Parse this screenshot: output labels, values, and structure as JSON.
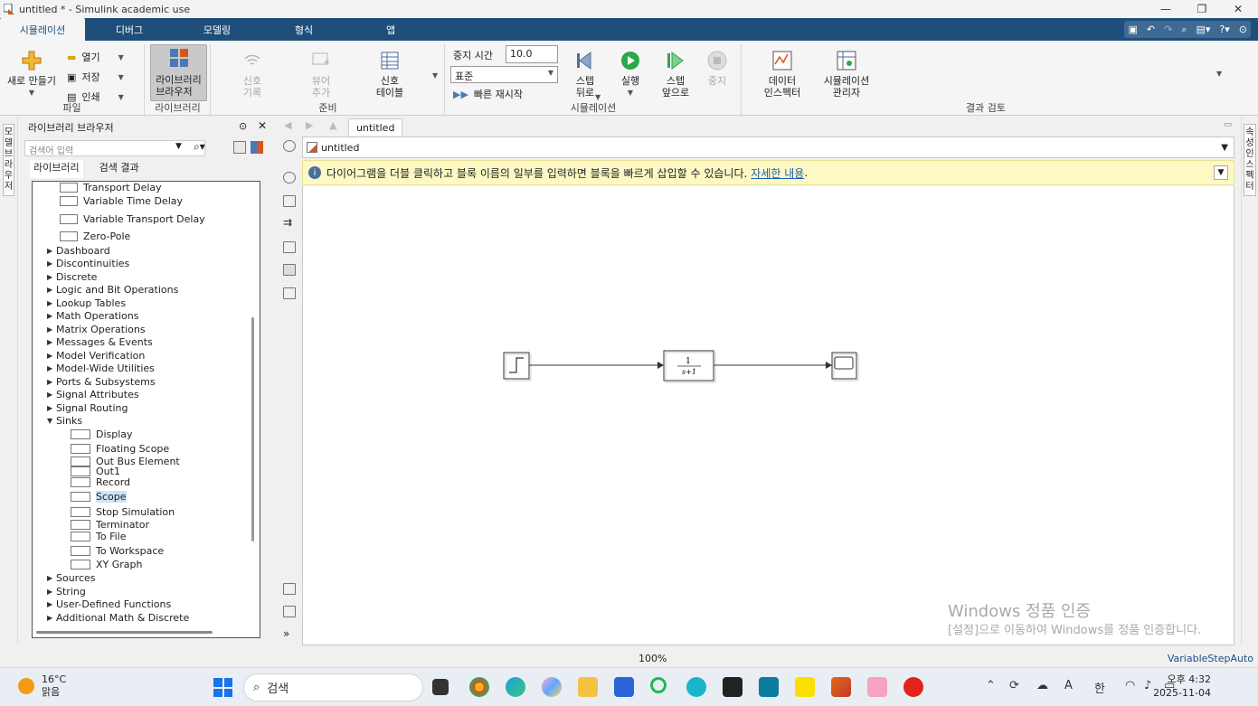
{
  "window": {
    "title": "untitled * - Simulink academic use"
  },
  "tabs": [
    "시뮬레이션",
    "디버그",
    "모델링",
    "형식",
    "앱"
  ],
  "ribbon": {
    "file": {
      "new_label": "새로 만들기",
      "open": "열기",
      "save": "저장",
      "print": "인쇄",
      "group": "파일"
    },
    "library": {
      "button": "라이브러리\n브라우저",
      "group": "라이브러리"
    },
    "prepare": {
      "signal_log": "신호\n기록",
      "viewer_add": "뷰어\n추가",
      "signal_table": "신호\n테이블",
      "group": "준비"
    },
    "simulation": {
      "stop_time_label": "중지 시간",
      "stop_time_value": "10.0",
      "mode": "표준",
      "fast_restart": "빠른 재시작",
      "step_back": "스텝\n뒤로",
      "run": "실행",
      "step_forward": "스텝\n앞으로",
      "stop": "중지",
      "group": "시뮬레이션"
    },
    "review": {
      "data_inspector": "데이터\n인스펙터",
      "sim_manager": "시뮬레이션\n관리자",
      "group": "결과 검토"
    }
  },
  "left_strip": "모델 브라우저",
  "right_strip": "속성 인스펙터",
  "library_browser": {
    "title": "라이브러리 브라우저",
    "search_placeholder": "검색어 입력",
    "tabs": [
      "라이브러리",
      "검색 결과"
    ],
    "tree": [
      {
        "label": "Transport Delay",
        "kind": "leaf1"
      },
      {
        "label": "Variable Time Delay",
        "kind": "leaf1"
      },
      {
        "label": "Variable Transport Delay",
        "kind": "leaf1"
      },
      {
        "label": "Zero-Pole",
        "kind": "leaf1"
      },
      {
        "label": "Dashboard",
        "kind": "folder"
      },
      {
        "label": "Discontinuities",
        "kind": "folder"
      },
      {
        "label": "Discrete",
        "kind": "folder"
      },
      {
        "label": "Logic and Bit Operations",
        "kind": "folder"
      },
      {
        "label": "Lookup Tables",
        "kind": "folder"
      },
      {
        "label": "Math Operations",
        "kind": "folder"
      },
      {
        "label": "Matrix Operations",
        "kind": "folder"
      },
      {
        "label": "Messages & Events",
        "kind": "folder"
      },
      {
        "label": "Model Verification",
        "kind": "folder"
      },
      {
        "label": "Model-Wide Utilities",
        "kind": "folder"
      },
      {
        "label": "Ports & Subsystems",
        "kind": "folder"
      },
      {
        "label": "Signal Attributes",
        "kind": "folder"
      },
      {
        "label": "Signal Routing",
        "kind": "folder"
      },
      {
        "label": "Sinks",
        "kind": "open"
      },
      {
        "label": "Display",
        "kind": "leaf"
      },
      {
        "label": "Floating Scope",
        "kind": "leaf"
      },
      {
        "label": "Out Bus Element",
        "kind": "leaf"
      },
      {
        "label": "Out1",
        "kind": "leaf"
      },
      {
        "label": "Record",
        "kind": "leaf"
      },
      {
        "label": "Scope",
        "kind": "leaf",
        "selected": true
      },
      {
        "label": "Stop Simulation",
        "kind": "leaf"
      },
      {
        "label": "Terminator",
        "kind": "leaf"
      },
      {
        "label": "To File",
        "kind": "leaf"
      },
      {
        "label": "To Workspace",
        "kind": "leaf"
      },
      {
        "label": "XY Graph",
        "kind": "leaf"
      },
      {
        "label": "Sources",
        "kind": "folder"
      },
      {
        "label": "String",
        "kind": "folder"
      },
      {
        "label": "User-Defined Functions",
        "kind": "folder"
      },
      {
        "label": "Additional Math & Discrete",
        "kind": "folder"
      }
    ]
  },
  "editor": {
    "doc_tab": "untitled",
    "address": "untitled",
    "info_text": "다이어그램을 더블 클릭하고 블록 이름의 일부를 입력하면 블록을 빠르게 삽입할 수 있습니다.",
    "info_link": "자세한 내용",
    "info_end": ".",
    "transfer_num": "1",
    "transfer_den": "s+1",
    "watermark_title": "Windows 정품 인증",
    "watermark_text": "[설정]으로 이동하여 Windows를 정품 인증합니다."
  },
  "status": {
    "zoom": "100%",
    "solver": "VariableStepAuto"
  },
  "taskbar": {
    "temperature": "16°C",
    "condition": "맑음",
    "search": "검색",
    "ime": "한",
    "font_a": "A",
    "time": "오후 4:32",
    "date": "2025-11-04"
  }
}
